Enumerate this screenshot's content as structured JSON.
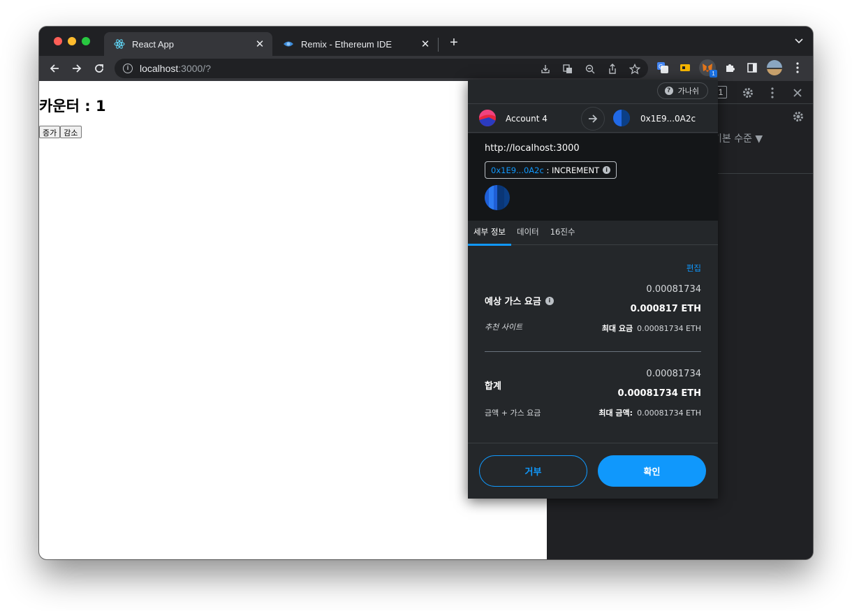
{
  "browser": {
    "tabs": [
      {
        "title": "React App",
        "active": true
      },
      {
        "title": "Remix - Ethereum IDE",
        "active": false
      }
    ],
    "url_host": "localhost",
    "url_rest": ":3000/?",
    "ext_badge": "1"
  },
  "page": {
    "heading": "카운터 : 1",
    "increase": "증가",
    "decrease": "감소"
  },
  "devtools": {
    "badge": "1",
    "level": "기본 수준 ▼"
  },
  "metamask": {
    "network": "가나쉬",
    "from_account": "Account 4",
    "to_account": "0x1E9...0A2c",
    "origin": "http://localhost:3000",
    "method_address": "0x1E9...0A2c",
    "method_sep": " : ",
    "method_name": "INCREMENT",
    "tabs": [
      "세부 정보",
      "데이터",
      "16진수"
    ],
    "edit": "편집",
    "gas": {
      "label": "예상 가스 요금",
      "value": "0.00081734",
      "value_eth": "0.000817 ETH",
      "sub_left": "추천 사이트",
      "max_label": "최대 요금",
      "max_value": "0.00081734 ETH"
    },
    "total": {
      "label": "합계",
      "value": "0.00081734",
      "value_eth": "0.00081734 ETH",
      "sub_left": "금액 + 가스 요금",
      "max_label": "최대 금액:",
      "max_value": "0.00081734 ETH"
    },
    "reject": "거부",
    "confirm": "확인"
  },
  "colors": {
    "accent": "#1098fc",
    "popup_bg": "#24272a",
    "chrome_bg": "#202124"
  }
}
